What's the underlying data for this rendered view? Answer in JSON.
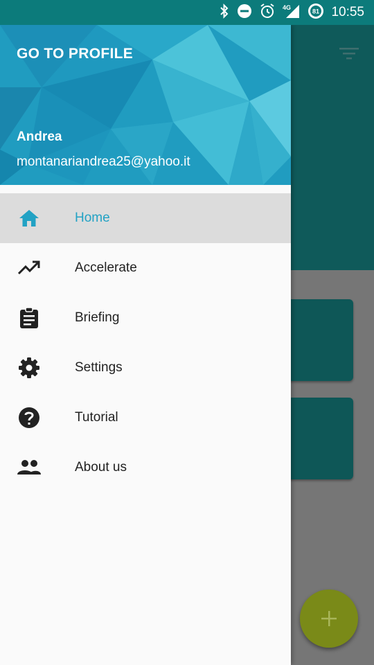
{
  "status_bar": {
    "time": "10:55",
    "battery": "81",
    "network": "4G",
    "icons": [
      "bluetooth-icon",
      "do-not-disturb-icon",
      "alarm-icon",
      "signal-icon",
      "battery-icon"
    ]
  },
  "drawer": {
    "header": {
      "profile_link": "GO TO PROFILE",
      "name": "Andrea",
      "email": "montanariandrea25@yahoo.it"
    },
    "items": [
      {
        "label": "Home",
        "icon": "home-icon",
        "selected": true
      },
      {
        "label": "Accelerate",
        "icon": "trending-up-icon",
        "selected": false
      },
      {
        "label": "Briefing",
        "icon": "clipboard-icon",
        "selected": false
      },
      {
        "label": "Settings",
        "icon": "gear-icon",
        "selected": false
      },
      {
        "label": "Tutorial",
        "icon": "help-icon",
        "selected": false
      },
      {
        "label": "About us",
        "icon": "people-icon",
        "selected": false
      }
    ]
  },
  "background_app": {
    "fab_label": "+",
    "toolbar_icon": "filter-icon"
  },
  "colors": {
    "status_bar": "#0c7b7b",
    "accent": "#22a2c4",
    "selected_bg": "#dcdcdc",
    "drawer_bg": "#fafafa",
    "fab": "#7a8a18"
  }
}
